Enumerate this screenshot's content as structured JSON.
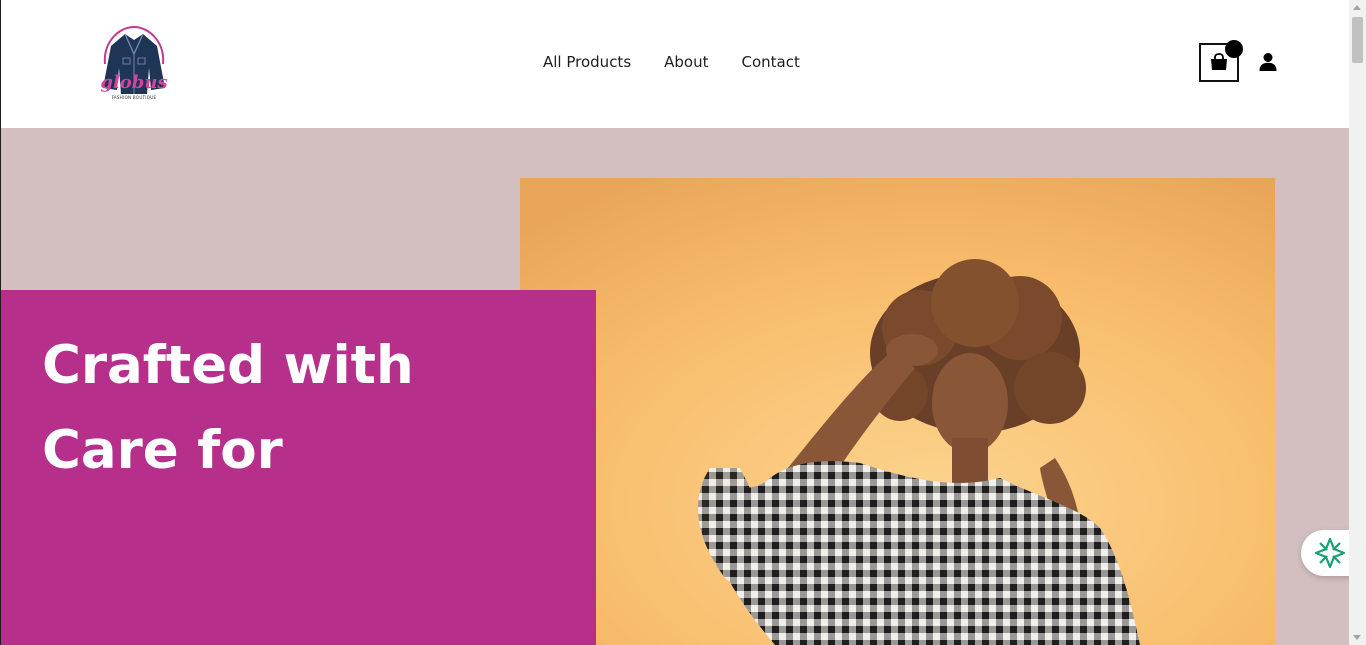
{
  "header": {
    "logo_wordmark": "globus",
    "logo_tagline": "FASHION BOUTIQUE",
    "nav": [
      {
        "label": "All Products"
      },
      {
        "label": "About"
      },
      {
        "label": "Contact"
      }
    ],
    "cart_icon": "shopping-bag-icon",
    "account_icon": "user-icon"
  },
  "hero": {
    "heading": "Crafted with Care for",
    "colors": {
      "card": "#b52f8b",
      "background": "#d3bfbf",
      "photo_backdrop": "#f7b866"
    }
  },
  "widget": {
    "icon": "assistant-sparkle-icon"
  }
}
